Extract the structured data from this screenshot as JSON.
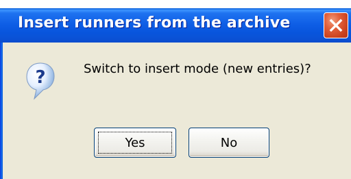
{
  "window": {
    "title": "Insert runners from the archive",
    "close_icon": "close-icon"
  },
  "message": {
    "text": "Switch to insert mode (new entries)?",
    "icon": "question-icon"
  },
  "buttons": {
    "yes_label": "Yes",
    "no_label": "No"
  },
  "colors": {
    "titlebar": "#0a52d6",
    "dialog_bg": "#ece9d8",
    "close_button": "#e2603a"
  }
}
